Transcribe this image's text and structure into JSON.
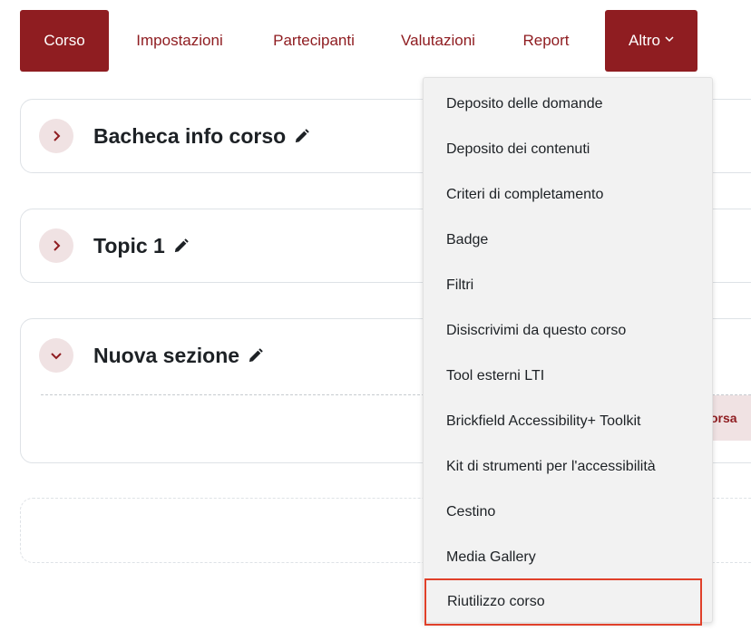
{
  "nav": {
    "items": [
      {
        "label": "Corso",
        "active": true
      },
      {
        "label": "Impostazioni"
      },
      {
        "label": "Partecipanti"
      },
      {
        "label": "Valutazioni"
      },
      {
        "label": "Report"
      }
    ],
    "more_label": "Altro",
    "more_icon": "chevron-down-icon"
  },
  "sections": [
    {
      "title": "Bacheca info corso",
      "state": "collapsed"
    },
    {
      "title": "Topic 1",
      "state": "collapsed"
    },
    {
      "title": "Nuova sezione",
      "state": "expanded",
      "partial_button_text": "orsa"
    }
  ],
  "dropdown": {
    "items": [
      "Deposito delle domande",
      "Deposito dei contenuti",
      "Criteri di completamento",
      "Badge",
      "Filtri",
      "Disiscrivimi da questo corso",
      "Tool esterni LTI",
      "Brickfield Accessibility+ Toolkit",
      "Kit di strumenti per l'accessibilità",
      "Cestino",
      "Media Gallery",
      "Riutilizzo corso"
    ],
    "highlighted": "Riutilizzo corso"
  },
  "colors": {
    "accent": "#8f1d21",
    "toggle_bg": "#f0e2e3",
    "highlight_border": "#e0402a"
  }
}
